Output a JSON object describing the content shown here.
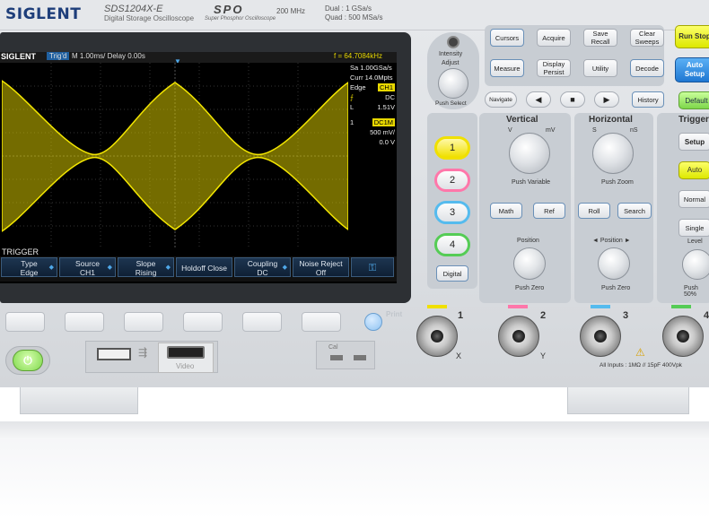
{
  "header": {
    "brand": "SIGLENT",
    "model": "SDS1204X-E",
    "model_sub": "Digital Storage Oscilloscope",
    "spo": "SPO",
    "spo_sub": "Super Phosphor Oscilloscope",
    "bandwidth": "200 MHz",
    "sample_dual": "Dual : 1 GSa/s",
    "sample_quad": "Quad : 500 MSa/s"
  },
  "screen": {
    "logo": "SIGLENT",
    "run_state": "Trig'd",
    "timebase": "M 1.00ms/ Delay 0.00s",
    "freq": "f = 64.7084kHz",
    "sample_rate": "Sa 1.00GSa/s",
    "memory": "Curr 14.0Mpts",
    "trig_type": "Edge",
    "trig_source": "CH1",
    "trig_coupling": "DC",
    "trig_level_label": "L",
    "trig_level": "1.51V",
    "ch_num": "1",
    "ch_coupling": "DC1M",
    "ch_scale": "500 mV/",
    "ch_offset": "0.0 V",
    "menu_title": "TRIGGER",
    "menu": [
      {
        "top": "Type",
        "bottom": "Edge"
      },
      {
        "top": "Source",
        "bottom": "CH1"
      },
      {
        "top": "Slope",
        "bottom": "Rising"
      },
      {
        "top": "Holdoff Close",
        "bottom": ""
      },
      {
        "top": "Coupling",
        "bottom": "DC"
      },
      {
        "top": "Noise Reject",
        "bottom": "Off"
      }
    ]
  },
  "controls": {
    "intensity": "Intensity",
    "adjust": "Adjust",
    "select": "Push Select",
    "cursors": "Cursors",
    "acquire": "Acquire",
    "save_recall": "Save Recall",
    "clear_sweeps": "Clear Sweeps",
    "run_stop": "Run Stop",
    "measure": "Measure",
    "display_persist": "Display Persist",
    "utility": "Utility",
    "decode": "Decode",
    "auto_setup": "Auto Setup",
    "navigate": "Navigate",
    "history": "History",
    "default": "Default",
    "vertical": "Vertical",
    "horizontal": "Horizontal",
    "trigger": "Trigger",
    "variable": "Push Variable",
    "zoom": "Push Zoom",
    "math": "Math",
    "ref": "Ref",
    "roll": "Roll",
    "search": "Search",
    "position": "Position",
    "h_position": "◄ Position ►",
    "push_zero": "Push Zero",
    "level": "Level",
    "push_50": "Push 50%",
    "setup": "Setup",
    "auto": "Auto",
    "normal": "Normal",
    "single": "Single",
    "digital": "Digital",
    "v_label": "V",
    "mv_label": "mV",
    "s_label": "S",
    "ns_label": "nS",
    "channels": [
      "1",
      "2",
      "3",
      "4"
    ],
    "print": "Print",
    "usb": "USB Host",
    "video": "Video",
    "cal": "Cal",
    "inputs_note": "All Inputs : 1MΩ // 15pF  400Vpk",
    "bnc_labels": [
      "1",
      "2",
      "3",
      "4"
    ],
    "bnc_sub": [
      "X",
      "Y"
    ]
  },
  "colors": {
    "ch1": "#f0e000",
    "ch2": "#ff77aa",
    "ch3": "#55bbee",
    "ch4": "#55cc55",
    "waveform": "#e8d800",
    "accent_blue": "#1f77d2"
  },
  "icons": [
    "power-icon",
    "usb-icon",
    "hdmi-icon",
    "arrow-left-icon",
    "stop-icon",
    "arrow-right-icon",
    "warning-icon"
  ]
}
